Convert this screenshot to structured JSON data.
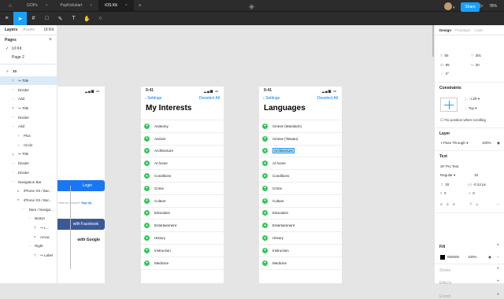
{
  "tabs": [
    {
      "label": "GOPs"
    },
    {
      "label": "PayKickstart"
    },
    {
      "label": "iOS Kit"
    }
  ],
  "header": {
    "share_label": "Share",
    "zoom": "78%"
  },
  "left_panel": {
    "tab_layers": "Layers",
    "tab_assets": "Assets",
    "kit_label": "UI Kit",
    "pages_heading": "Pages",
    "pages": [
      "UI Kit",
      "Page 2"
    ],
    "frame_label": "10",
    "layers": [
      {
        "icon": "T",
        "label": "↪ Title",
        "indent": 7,
        "selected": true
      },
      {
        "icon": "⋯",
        "label": "Divider",
        "indent": 7
      },
      {
        "icon": "⋯",
        "label": "Add",
        "indent": 7
      },
      {
        "icon": "T",
        "label": "↪ Title",
        "indent": 7
      },
      {
        "icon": "⋯",
        "label": "Divider",
        "indent": 7
      },
      {
        "icon": "⋯",
        "label": "Add",
        "indent": 7
      },
      {
        "icon": "+",
        "label": "Plus",
        "indent": 14
      },
      {
        "icon": "○",
        "label": "Circle",
        "indent": 14
      },
      {
        "icon": "T",
        "label": "↪ Title",
        "indent": 7
      },
      {
        "icon": "⋯",
        "label": "Divider",
        "indent": 7
      },
      {
        "icon": "⋯",
        "label": "Divider",
        "indent": 7
      },
      {
        "icon": "⋯",
        "label": "Navigation Bar",
        "indent": 7
      },
      {
        "icon": "▸",
        "label": "iPhone XS / Bar...",
        "indent": 14
      },
      {
        "icon": "▸",
        "label": "iPhone XS / Bar...",
        "indent": 14
      },
      {
        "icon": "⋯",
        "label": "Bars / Naviga...",
        "indent": 21
      },
      {
        "icon": "⋯",
        "label": "Button",
        "indent": 28
      },
      {
        "icon": "T",
        "label": "↪ L...",
        "indent": 35
      },
      {
        "icon": "▸",
        "label": "Arrow",
        "indent": 35
      },
      {
        "icon": "⋯",
        "label": "Right",
        "indent": 28
      },
      {
        "icon": "T",
        "label": "↪ Label",
        "indent": 35
      }
    ]
  },
  "canvas": {
    "frame1": {
      "login_label": "Login",
      "signup_prefix": "Have an account?",
      "signup_label": "Sign Up",
      "facebook_label": "with Facebook",
      "google_label": "with Google"
    },
    "frame2": {
      "time": "9:41",
      "back_label": "Settings",
      "action_label": "Deselect All",
      "title": "My Interests",
      "items": [
        "Anatomy",
        "Animal",
        "Architecture",
        "At home",
        "Conditions",
        "Crime",
        "Culture",
        "Education",
        "Entertainment",
        "History",
        "Instruction",
        "Medicine"
      ]
    },
    "frame3": {
      "time": "9:41",
      "back_label": "Settings",
      "action_label": "Deselect All",
      "title": "Languages",
      "items": [
        "Cinese (Mandarin)",
        "Cinese (Taiwan)",
        "Architecture",
        "At home",
        "Conditions",
        "Crime",
        "Culture",
        "Education",
        "Entertainment",
        "History",
        "Instruction",
        "Medicine"
      ],
      "highlighted_index": 2
    }
  },
  "right_panel": {
    "tab_design": "Design",
    "tab_prototype": "Prototype",
    "tab_code": "Code",
    "x_label": "X",
    "x": "55",
    "y_label": "Y",
    "y": "301",
    "w_label": "W",
    "w": "85",
    "h_label": "H",
    "h": "20",
    "rotation": "0°",
    "constraints_heading": "Constraints",
    "constraint_h": "Left",
    "constraint_v": "Top",
    "fix_scroll_label": "Fix position when scrolling",
    "layer_heading": "Layer",
    "blend_mode": "Pass Through",
    "layer_opacity": "100%",
    "text_heading": "Text",
    "font_family": "SF Pro Text",
    "font_weight": "Regular",
    "font_size": "15",
    "line_height": "20",
    "letter_spacing": "-0.24 px",
    "paragraph_spacing": "0",
    "paragraph_indent": "0",
    "fill_heading": "Fill",
    "fill_hex": "000000",
    "fill_opacity": "100%",
    "stroke_heading": "Stroke",
    "effects_heading": "Effects",
    "export_heading": "Export"
  },
  "colors": {
    "accent": "#18a0fb",
    "ios_green": "#34c759",
    "ios_blue": "#007aff",
    "facebook": "#3b5998"
  }
}
